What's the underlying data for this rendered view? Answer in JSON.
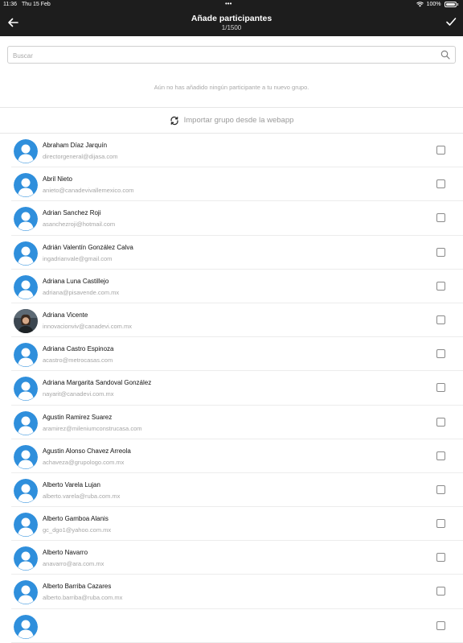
{
  "status_bar": {
    "time": "11:36",
    "date": "Thu 15 Feb",
    "dots": "•••",
    "battery": "100%"
  },
  "nav": {
    "title": "Añade participantes",
    "subtitle": "1/1500",
    "back_icon": "arrow-left-icon",
    "confirm_icon": "check-icon"
  },
  "search": {
    "placeholder": "Buscar",
    "value": "",
    "icon": "search-icon"
  },
  "empty_message": "Aún no has añadido ningún participante a tu nuevo grupo.",
  "import_action": {
    "label": "Importar grupo desde la webapp",
    "icon": "sync-icon"
  },
  "colors": {
    "header_bg": "#1d1d1d",
    "avatar_blue": "#2f8fdc"
  },
  "contacts": [
    {
      "name": "Abraham Díaz Jarquín",
      "email": "directorgeneral@dijasa.com",
      "avatar": "default"
    },
    {
      "name": "Abril Nieto",
      "email": "anieto@canadevivallemexico.com",
      "avatar": "default"
    },
    {
      "name": "Adrian Sanchez Roji",
      "email": "asanchezroji@hotmail.com",
      "avatar": "default"
    },
    {
      "name": "Adrián Valentín González Calva",
      "email": "ingadrianvale@gmail.com",
      "avatar": "default"
    },
    {
      "name": "Adriana Luna Castillejo",
      "email": "adriana@pisavende.com.mx",
      "avatar": "default"
    },
    {
      "name": "Adriana Vicente",
      "email": "innovacionviv@canadevi.com.mx",
      "avatar": "photo"
    },
    {
      "name": "Adriana Castro Espinoza",
      "email": "acastro@metrocasas.com",
      "avatar": "default"
    },
    {
      "name": "Adriana Margarita Sandoval González",
      "email": "nayarit@canadevi.com.mx",
      "avatar": "default"
    },
    {
      "name": "Agustin Ramirez Suarez",
      "email": "aramirez@mileniumconstrucasa.com",
      "avatar": "default"
    },
    {
      "name": "Agustin Alonso Chavez Arreola",
      "email": "achaveza@grupologo.com.mx",
      "avatar": "default"
    },
    {
      "name": "Alberto Varela Lujan",
      "email": "alberto.varela@ruba.com.mx",
      "avatar": "default"
    },
    {
      "name": "Alberto Gamboa Alanis",
      "email": "gc_dgo1@yahoo.com.mx",
      "avatar": "default"
    },
    {
      "name": "Alberto Navarro",
      "email": "anavarro@ara.com.mx",
      "avatar": "default"
    },
    {
      "name": "Alberto Barriba Cazares",
      "email": "alberto.barriba@ruba.com.mx",
      "avatar": "default"
    },
    {
      "name": "",
      "email": "",
      "avatar": "default"
    }
  ]
}
